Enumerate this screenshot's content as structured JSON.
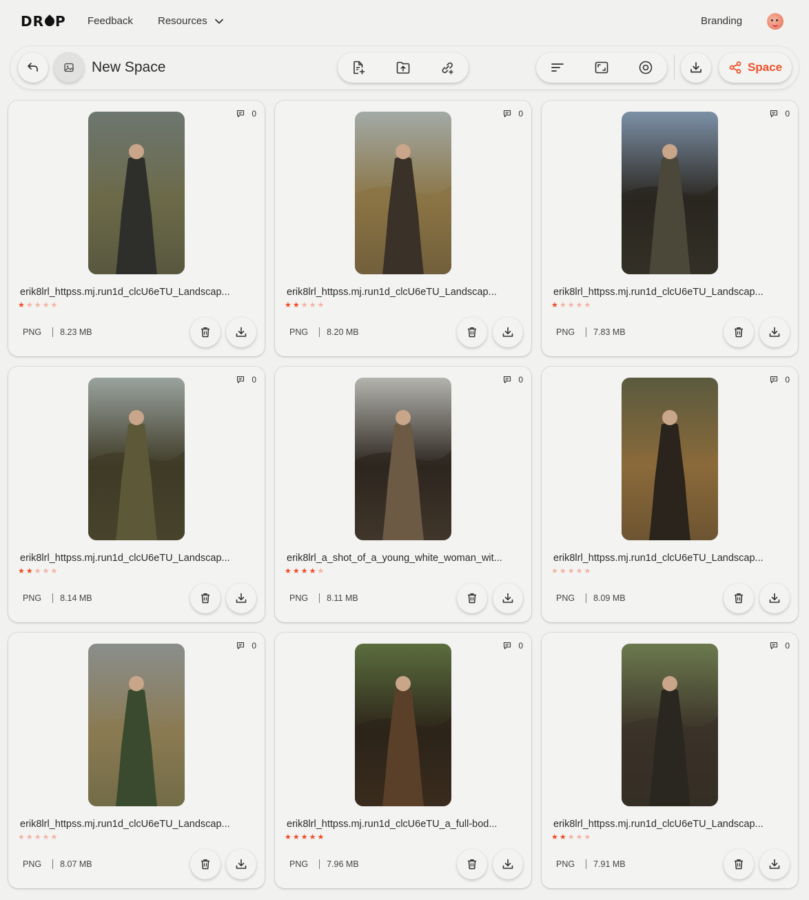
{
  "nav": {
    "logo": "DROP",
    "feedback": "Feedback",
    "resources": "Resources",
    "branding": "Branding"
  },
  "toolbar": {
    "title": "New Space",
    "share_label": "Space",
    "icons": [
      "back-arrow-icon",
      "image-icon",
      "file-add-icon",
      "upload-icon",
      "link-add-icon",
      "sort-icon",
      "aspect-ratio-icon",
      "settings-icon",
      "download-icon",
      "share-icon"
    ]
  },
  "colors": {
    "accent": "#ef4b24",
    "background": "#f1f1f0",
    "star_off": "#f3b2a2"
  },
  "cards": [
    {
      "filename": "erik8lrl_httpss.mj.run1d_clcU6eTU_Landscap...",
      "rating": 1,
      "format": "PNG",
      "size": "8.23 MB",
      "comments": "0",
      "palette": [
        "#6d7670",
        "#2e2f2a",
        "#6b6a48"
      ]
    },
    {
      "filename": "erik8lrl_httpss.mj.run1d_clcU6eTU_Landscap...",
      "rating": 2,
      "format": "PNG",
      "size": "8.20 MB",
      "comments": "0",
      "palette": [
        "#a3aaa6",
        "#3a3228",
        "#8a7444"
      ]
    },
    {
      "filename": "erik8lrl_httpss.mj.run1d_clcU6eTU_Landscap...",
      "rating": 1,
      "format": "PNG",
      "size": "7.83 MB",
      "comments": "0",
      "palette": [
        "#7c90a6",
        "#4b4739",
        "#2a2620"
      ]
    },
    {
      "filename": "erik8lrl_httpss.mj.run1d_clcU6eTU_Landscap...",
      "rating": 2,
      "format": "PNG",
      "size": "8.14 MB",
      "comments": "0",
      "palette": [
        "#9aa39e",
        "#5c5838",
        "#3e3a26"
      ]
    },
    {
      "filename": "erik8lrl_a_shot_of_a_young_white_woman_wit...",
      "rating": 4,
      "format": "PNG",
      "size": "8.11 MB",
      "comments": "0",
      "palette": [
        "#b4b4ae",
        "#6c5a44",
        "#2d2620"
      ]
    },
    {
      "filename": "erik8lrl_httpss.mj.run1d_clcU6eTU_Landscap...",
      "rating": 0,
      "format": "PNG",
      "size": "8.09 MB",
      "comments": "0",
      "palette": [
        "#5b5a3e",
        "#2a241c",
        "#8a6a3a"
      ]
    },
    {
      "filename": "erik8lrl_httpss.mj.run1d_clcU6eTU_Landscap...",
      "rating": 0,
      "format": "PNG",
      "size": "8.07 MB",
      "comments": "0",
      "palette": [
        "#8a8e8c",
        "#3a4a2e",
        "#8a7a52"
      ]
    },
    {
      "filename": "erik8lrl_httpss.mj.run1d_clcU6eTU_a_full-bod...",
      "rating": 5,
      "format": "PNG",
      "size": "7.96 MB",
      "comments": "0",
      "palette": [
        "#5b6e3e",
        "#5a4028",
        "#2c2419"
      ]
    },
    {
      "filename": "erik8lrl_httpss.mj.run1d_clcU6eTU_Landscap...",
      "rating": 2,
      "format": "PNG",
      "size": "7.91 MB",
      "comments": "0",
      "palette": [
        "#6c7a4e",
        "#2a2620",
        "#3a3228"
      ]
    }
  ]
}
